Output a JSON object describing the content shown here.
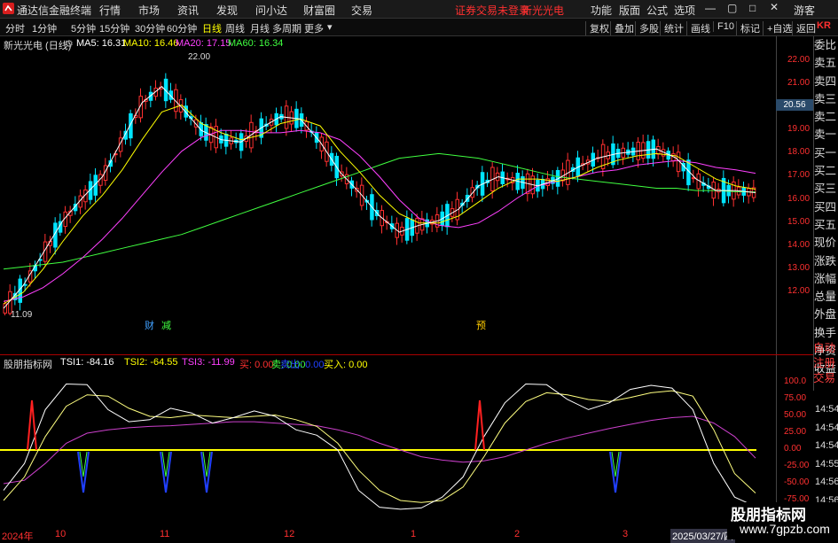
{
  "menubar": {
    "app_title": "通达信金融终端",
    "items": [
      "行情",
      "市场",
      "资讯",
      "发现",
      "问小达",
      "财富圈",
      "交易"
    ],
    "notice": "证券交易未登录",
    "stock_name": "新光光电",
    "right_items": [
      "功能",
      "版面",
      "公式",
      "选项"
    ],
    "user": "游客"
  },
  "toolbar": {
    "periods": [
      "分时",
      "1分钟",
      "5分钟",
      "15分钟",
      "30分钟",
      "60分钟",
      "日线",
      "周线",
      "月线",
      "多周期",
      "更多"
    ],
    "active_period": "日线",
    "buttons": [
      "复权",
      "叠加",
      "多股",
      "统计",
      "画线",
      "F10",
      "标记",
      "+自选",
      "返回"
    ]
  },
  "main_chart": {
    "stock_label": "新光光电 (日线)",
    "ma": [
      {
        "label": "MA5: 16.31",
        "color": "#ffffff"
      },
      {
        "label": "MA10: 16.46",
        "color": "#ffff00"
      },
      {
        "label": "MA20: 17.15",
        "color": "#ff40ff"
      },
      {
        "label": "MA60: 16.34",
        "color": "#40ff40"
      }
    ],
    "high_label": "22.00",
    "low_label": "11.09",
    "current_price": "20.56",
    "yticks": [
      "22.00",
      "21.00",
      "20.00",
      "19.00",
      "18.00",
      "17.00",
      "16.00",
      "15.00",
      "14.00",
      "13.00",
      "12.00"
    ],
    "markers": [
      {
        "text": "财",
        "color": "#40a0ff"
      },
      {
        "text": "减",
        "color": "#40ff40"
      },
      {
        "text": "预",
        "color": "#ffcc00"
      }
    ]
  },
  "sidebar": [
    "委比",
    "卖五",
    "卖四",
    "卖三",
    "卖二",
    "卖一",
    "买一",
    "买二",
    "买三",
    "买四",
    "买五",
    "现价",
    "涨跌",
    "涨幅",
    "总量",
    "外盘",
    "换手",
    "净资",
    "收益"
  ],
  "sidebar_red": [
    "自动",
    "注册",
    "交易"
  ],
  "indicator": {
    "name": "股朋指标网",
    "tsi1": "TSI1: -84.16",
    "tsi2": "TSI2: -64.55",
    "tsi3": "TSI3: -11.99",
    "buy": "买: 0.00",
    "sell": "卖: 0.00",
    "sell_out": "卖出: 0.00",
    "buy_in": "买入: 0.00",
    "yticks": [
      "100.0",
      "75.00",
      "50.00",
      "25.00",
      "0.00",
      "-25.00",
      "-50.00",
      "-75.00"
    ],
    "time_labels": [
      "14:54",
      "14:54",
      "14:54",
      "14:55",
      "14:56",
      "14:56"
    ]
  },
  "xaxis": [
    "2024年",
    "10",
    "11",
    "12",
    "1",
    "2",
    "3",
    "2025/03/27/四"
  ],
  "watermark": {
    "title": "股朋指标网",
    "url": "www.7gpzb.com"
  },
  "colors": {
    "up": "#ff3030",
    "down": "#00e5ff",
    "ma5": "#ffffff",
    "ma10": "#ffff00",
    "ma20": "#ff40ff",
    "ma60": "#40ff40"
  },
  "chart_data": {
    "type": "line",
    "ylim": [
      11,
      22.5
    ],
    "ma60": [
      13.0,
      13.1,
      13.2,
      13.3,
      13.5,
      13.7,
      13.9,
      14.1,
      14.3,
      14.5,
      14.8,
      15.1,
      15.4,
      15.7,
      16.0,
      16.3,
      16.6,
      16.9,
      17.2,
      17.5,
      17.8,
      17.9,
      18.0,
      17.9,
      17.8,
      17.6,
      17.4,
      17.2,
      17.0,
      16.9,
      16.8,
      16.7,
      16.6,
      16.5,
      16.5,
      16.4,
      16.4,
      16.35,
      16.34
    ],
    "ma20": [
      11.6,
      11.8,
      12.2,
      12.8,
      13.5,
      14.3,
      15.2,
      16.2,
      17.2,
      18.1,
      18.7,
      19.0,
      19.0,
      18.9,
      18.9,
      19.0,
      18.9,
      18.6,
      17.9,
      17.0,
      16.0,
      15.2,
      14.9,
      14.8,
      15.0,
      15.5,
      16.1,
      16.6,
      16.8,
      17.0,
      17.2,
      17.3,
      17.5,
      17.6,
      17.7,
      17.6,
      17.4,
      17.3,
      17.15
    ],
    "ma10": [
      11.5,
      12.0,
      13.0,
      14.2,
      15.3,
      16.2,
      17.3,
      18.6,
      19.8,
      20.1,
      19.3,
      18.9,
      18.6,
      18.8,
      19.3,
      19.5,
      19.2,
      18.1,
      17.2,
      16.2,
      15.4,
      15.0,
      15.0,
      15.3,
      15.9,
      16.5,
      16.9,
      16.9,
      16.8,
      17.0,
      17.4,
      17.7,
      17.9,
      18.0,
      17.9,
      17.4,
      16.9,
      16.6,
      16.46
    ],
    "ma5": [
      11.3,
      12.3,
      13.7,
      15.1,
      16.1,
      17.0,
      18.6,
      20.2,
      20.9,
      20.0,
      19.0,
      18.6,
      18.5,
      19.1,
      19.6,
      19.5,
      18.5,
      17.2,
      16.3,
      15.3,
      14.6,
      14.9,
      15.1,
      15.6,
      16.6,
      17.0,
      16.8,
      16.6,
      16.9,
      17.4,
      17.8,
      18.0,
      18.1,
      18.2,
      17.8,
      16.9,
      16.4,
      16.4,
      16.31
    ],
    "tsi1": [
      -60,
      -20,
      60,
      98,
      97,
      60,
      42,
      45,
      62,
      55,
      40,
      48,
      58,
      50,
      30,
      22,
      0,
      -60,
      -85,
      -88,
      -86,
      -70,
      -40,
      20,
      70,
      98,
      97,
      75,
      60,
      70,
      90,
      96,
      92,
      60,
      -20,
      -70,
      -84
    ],
    "tsi2": [
      -75,
      -40,
      20,
      65,
      82,
      80,
      62,
      50,
      48,
      52,
      50,
      48,
      50,
      52,
      45,
      35,
      10,
      -30,
      -60,
      -75,
      -78,
      -75,
      -55,
      -10,
      40,
      72,
      85,
      82,
      75,
      72,
      78,
      85,
      88,
      80,
      30,
      -35,
      -64
    ],
    "tsi3": [
      -50,
      -45,
      -20,
      10,
      25,
      30,
      33,
      35,
      36,
      38,
      40,
      42,
      42,
      40,
      38,
      36,
      30,
      22,
      10,
      0,
      -10,
      -15,
      -18,
      -16,
      -10,
      0,
      10,
      18,
      25,
      32,
      38,
      44,
      48,
      50,
      40,
      20,
      -12
    ]
  }
}
